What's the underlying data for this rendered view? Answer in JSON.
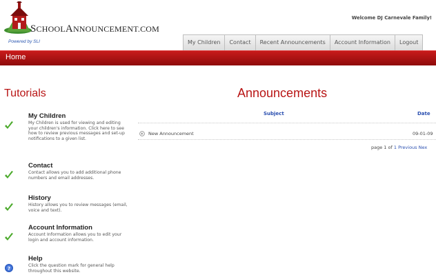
{
  "brand": {
    "logo_text_prefix": "S",
    "logo_text_rest": "CHOOL",
    "logo_text_prefix2": "A",
    "logo_text_rest2": "NNOUNCEMENT.COM",
    "powered_by": "Powered by SLI",
    "accent": "#b81414"
  },
  "header": {
    "welcome": "Welcome DJ Carnevale Family!"
  },
  "tabs": [
    {
      "label": "My Children"
    },
    {
      "label": "Contact"
    },
    {
      "label": "Recent Announcements"
    },
    {
      "label": "Account Information"
    },
    {
      "label": "Logout"
    }
  ],
  "homebar": {
    "label": "Home",
    "color": "#a81010"
  },
  "tutorials": {
    "title": "Tutorials",
    "items": [
      {
        "heading": "My Children",
        "icon": "check-icon",
        "description": "My Children is used for viewing and editing your children's information. Click here to see how to review previous messages and set-up notifications to a given list."
      },
      {
        "heading": "Contact",
        "icon": "check-icon",
        "description": "Contact allows you to add additional phone numbers and email addresses."
      },
      {
        "heading": "History",
        "icon": "check-icon",
        "description": "History allows you to review messages (email, voice and text)."
      },
      {
        "heading": "Account Information",
        "icon": "check-icon",
        "description": "Account Information allows you to edit your login and account information."
      },
      {
        "heading": "Help",
        "icon": "help-icon",
        "description": "Click the question mark for general help throughout this website."
      }
    ]
  },
  "announcements": {
    "title": "Announcements",
    "columns": {
      "subject": "Subject",
      "date": "Date"
    },
    "rows": [
      {
        "subject": "New Announcement",
        "date": "09-01-09"
      }
    ],
    "pager": {
      "text": "page 1 of",
      "page_link": "1",
      "previous": "Previous",
      "next": "Nex"
    }
  }
}
